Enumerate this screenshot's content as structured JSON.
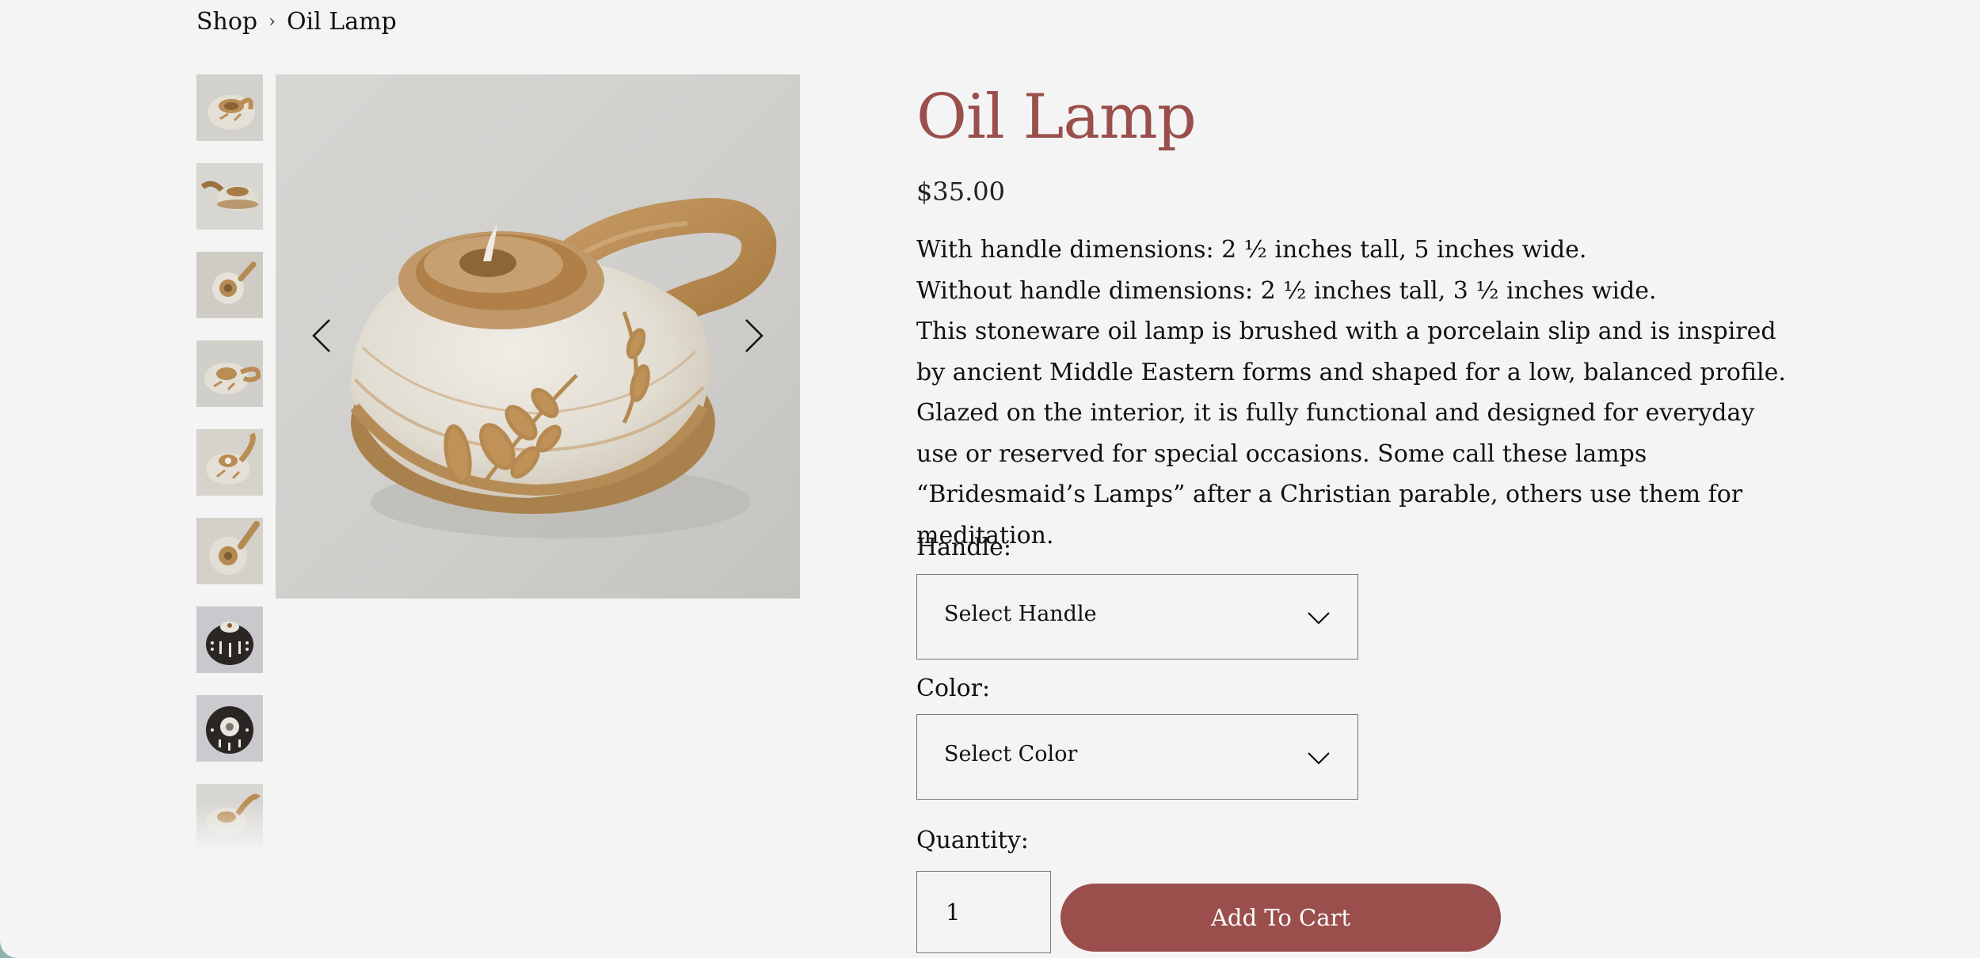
{
  "breadcrumb": {
    "shop": "Shop",
    "separator": "›",
    "current": "Oil Lamp"
  },
  "product": {
    "title": "Oil Lamp",
    "price": "$35.00",
    "description": [
      "With handle dimensions: 2 ½ inches tall, 5 inches wide.",
      "Without handle dimensions: 2 ½ inches tall, 3 ½ inches wide.",
      "This stoneware oil lamp is brushed with a porcelain slip and is inspired by ancient Middle Eastern forms and shaped for a low, balanced profile. Glazed on the interior, it is fully functional and designed for everyday use or reserved for special occasions.  Some call these lamps “Bridesmaid’s Lamps” after a Christian parable, others use them for meditation."
    ]
  },
  "options": {
    "handle_label": "Handle:",
    "handle_placeholder": "Select Handle",
    "color_label": "Color:",
    "color_placeholder": "Select Color",
    "quantity_label": "Quantity:",
    "quantity_value": "1",
    "add_to_cart": "Add To Cart"
  },
  "gallery": {
    "thumbnail_count": 9,
    "thumbnail_styles": [
      "white-slip",
      "white-slip-handle-left",
      "white-slip-top",
      "white-slip",
      "white-slip",
      "white-slip-top",
      "black-dotted",
      "black-dotted-top",
      "white-slip-faded"
    ],
    "prev_icon": "chevron-left-icon",
    "next_icon": "chevron-right-icon"
  },
  "colors": {
    "accent": "#9a4f4c",
    "background": "#f4f4f4",
    "text": "#111111",
    "clay": "#b98d55",
    "slip": "#e9e6df",
    "black_glaze": "#2a2624"
  }
}
